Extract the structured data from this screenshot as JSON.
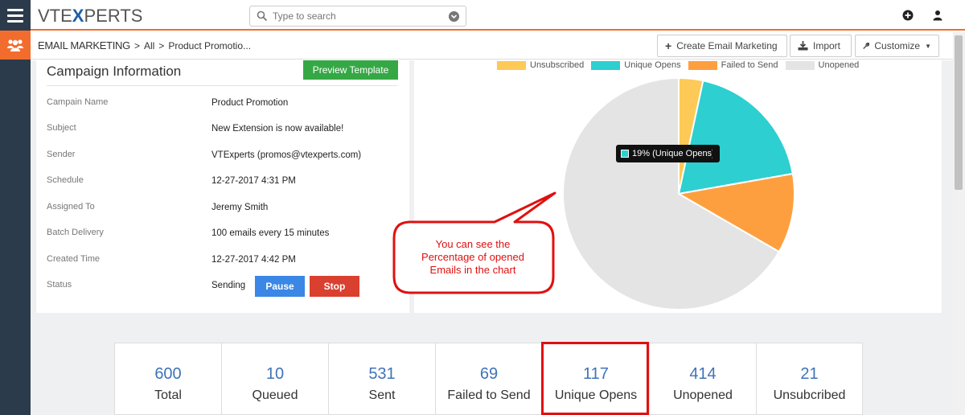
{
  "header": {
    "logo_left": "VTE",
    "logo_x": "X",
    "logo_right": "PERTS",
    "search_placeholder": "Type to search"
  },
  "breadcrumb": {
    "module": "Email Marketing",
    "all": "All",
    "record": "Product Promotio..."
  },
  "toolbar": {
    "create_label": "Create Email Marketing",
    "import_label": "Import",
    "customize_label": "Customize"
  },
  "campaign": {
    "title": "Campaign Information",
    "preview_label": "Preview Template",
    "rows": [
      {
        "label": "Campain Name",
        "value": "Product Promotion"
      },
      {
        "label": "Subject",
        "value": "New Extension is now available!"
      },
      {
        "label": "Sender",
        "value": "VTExperts (promos@vtexperts.com)"
      },
      {
        "label": "Schedule",
        "value": "12-27-2017 4:31 PM"
      },
      {
        "label": "Assigned To",
        "value": "Jeremy Smith"
      },
      {
        "label": "Batch Delivery",
        "value": "100 emails every 15 minutes"
      },
      {
        "label": "Created Time",
        "value": "12-27-2017 4:42 PM"
      },
      {
        "label": "Status",
        "value": "Sending"
      }
    ],
    "pause_label": "Pause",
    "stop_label": "Stop"
  },
  "chart_data": {
    "type": "pie",
    "categories": [
      "Unsubscribed",
      "Unique Opens",
      "Failed to Send",
      "Unopened"
    ],
    "values": [
      21,
      117,
      69,
      414
    ],
    "colors": [
      "#fdc957",
      "#2dcfd0",
      "#fe9f3f",
      "#e4e4e4"
    ],
    "legend_position": "top",
    "tooltip": "19% (Unique Opens)"
  },
  "callout": {
    "line1": "You can see the",
    "line2": "Percentage of opened",
    "line3": "Emails in the chart"
  },
  "stats": [
    {
      "value": "600",
      "label": "Total"
    },
    {
      "value": "10",
      "label": "Queued"
    },
    {
      "value": "531",
      "label": "Sent"
    },
    {
      "value": "69",
      "label": "Failed to Send"
    },
    {
      "value": "117",
      "label": "Unique Opens"
    },
    {
      "value": "414",
      "label": "Unopened"
    },
    {
      "value": "21",
      "label": "Unsubcribed"
    }
  ]
}
